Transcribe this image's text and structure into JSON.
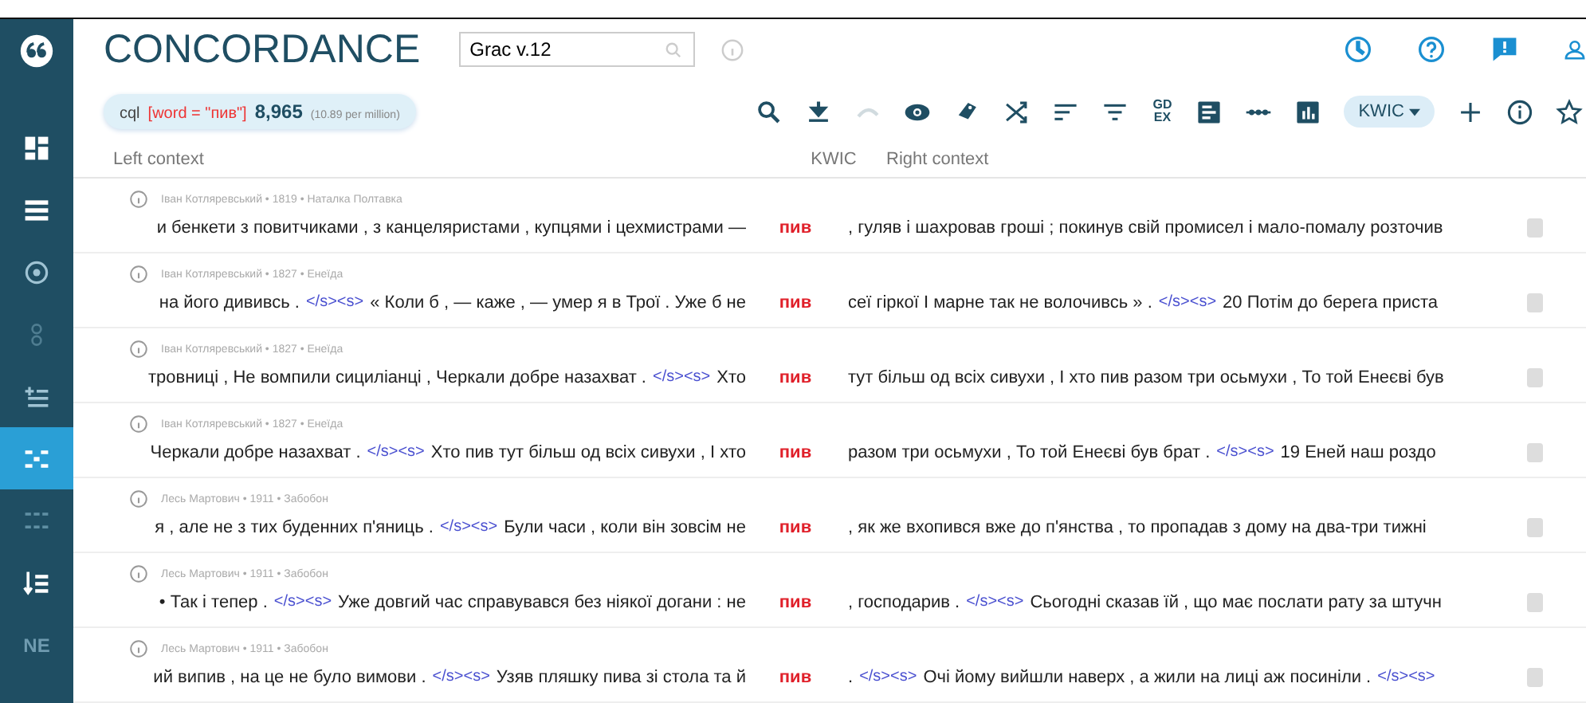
{
  "app": {
    "title": "CONCORDANCE",
    "corpus_field": {
      "value": "Grac v.12"
    }
  },
  "sidebar": {
    "items": [
      {
        "kind": "dashboard",
        "selected": false
      },
      {
        "kind": "list",
        "selected": false
      },
      {
        "kind": "target",
        "selected": false
      },
      {
        "kind": "faint",
        "selected": false
      },
      {
        "kind": "addlist",
        "selected": false
      },
      {
        "kind": "concordance",
        "selected": true
      },
      {
        "kind": "grid",
        "selected": false
      },
      {
        "kind": "sortlist",
        "selected": false
      },
      {
        "kind": "ne",
        "label": "NE",
        "selected": false
      }
    ]
  },
  "header_icons": [
    {
      "kind": "clock"
    },
    {
      "kind": "help"
    },
    {
      "kind": "feedback"
    },
    {
      "kind": "user"
    }
  ],
  "query": {
    "type": "cql",
    "expression": "[word = \"пив\"]",
    "count": "8,965",
    "frequency": "(10.89 per million)"
  },
  "tools": [
    {
      "kind": "search",
      "disabled": false
    },
    {
      "kind": "download",
      "disabled": false
    },
    {
      "kind": "undo",
      "disabled": true
    },
    {
      "kind": "eye",
      "disabled": false
    },
    {
      "kind": "tag",
      "disabled": false
    },
    {
      "kind": "shuffle",
      "disabled": false
    },
    {
      "kind": "sort",
      "disabled": false
    },
    {
      "kind": "filter",
      "disabled": false
    },
    {
      "kind": "gdex",
      "label": "GD EX",
      "disabled": false
    },
    {
      "kind": "doc",
      "disabled": false
    },
    {
      "kind": "dots",
      "disabled": false
    },
    {
      "kind": "chart",
      "disabled": false
    },
    {
      "kind": "dropdown",
      "label": "KWIC"
    },
    {
      "kind": "plus",
      "disabled": false
    },
    {
      "kind": "info",
      "disabled": false
    },
    {
      "kind": "star",
      "disabled": false
    }
  ],
  "columns": {
    "left": "Left context",
    "kwic": "KWIC",
    "right": "Right context"
  },
  "rows": [
    {
      "meta": "Іван Котляревський • 1819 • Наталка Полтавка",
      "left": [
        {
          "kind": "text",
          "text": "и бенкети з повитчиками , з канцеляристами , купцями і цехмистрами —"
        }
      ],
      "kwic": "пив",
      "right": [
        {
          "kind": "text",
          "text": ", гуляв і шахровав гроші ; покинув свій промисел і мало-помалу розточив"
        }
      ]
    },
    {
      "meta": "Іван Котляревський • 1827 • Енеїда",
      "left": [
        {
          "kind": "text",
          "text": "на його дививсь ."
        },
        {
          "kind": "tag",
          "text": "</s><s>"
        },
        {
          "kind": "text",
          "text": "« Коли б , — каже , — умер я в Трої . Уже б не"
        }
      ],
      "kwic": "пив",
      "right": [
        {
          "kind": "text",
          "text": "сеї гіркої І марне так не волочивсь » ."
        },
        {
          "kind": "tag",
          "text": "</s><s>"
        },
        {
          "kind": "text",
          "text": "20 Потім до берега приста"
        }
      ]
    },
    {
      "meta": "Іван Котляревський • 1827 • Енеїда",
      "left": [
        {
          "kind": "text",
          "text": "тровниці , Не вомпили сициліанці , Черкали добре назахват ."
        },
        {
          "kind": "tag",
          "text": "</s><s>"
        },
        {
          "kind": "text",
          "text": "Хто"
        }
      ],
      "kwic": "пив",
      "right": [
        {
          "kind": "text",
          "text": "тут більш од всіх сивухи , І хто пив разом три осьмухи , То той Енеєві був"
        }
      ]
    },
    {
      "meta": "Іван Котляревський • 1827 • Енеїда",
      "left": [
        {
          "kind": "text",
          "text": "Черкали добре назахват ."
        },
        {
          "kind": "tag",
          "text": "</s><s>"
        },
        {
          "kind": "text",
          "text": "Хто пив тут більш од всіх сивухи , І хто"
        }
      ],
      "kwic": "пив",
      "right": [
        {
          "kind": "text",
          "text": "разом три осьмухи , То той Енеєві був брат ."
        },
        {
          "kind": "tag",
          "text": "</s><s>"
        },
        {
          "kind": "text",
          "text": "19 Еней наш роздо"
        }
      ]
    },
    {
      "meta": "Лесь Мартович • 1911 • Забобон",
      "left": [
        {
          "kind": "text",
          "text": "я , але не з тих буденних п'яниць ."
        },
        {
          "kind": "tag",
          "text": "</s><s>"
        },
        {
          "kind": "text",
          "text": "Були часи , коли він зовсім не"
        }
      ],
      "kwic": "пив",
      "right": [
        {
          "kind": "text",
          "text": ", як же вхопився вже до п'янства , то пропадав з дому на два-три тижні"
        }
      ]
    },
    {
      "meta": "Лесь Мартович • 1911 • Забобон",
      "left": [
        {
          "kind": "text",
          "text": "• Так і тепер ."
        },
        {
          "kind": "tag",
          "text": "</s><s>"
        },
        {
          "kind": "text",
          "text": "Уже довгий час справувався без ніякої догани : не"
        }
      ],
      "kwic": "пив",
      "right": [
        {
          "kind": "text",
          "text": ", господарив ."
        },
        {
          "kind": "tag",
          "text": "</s><s>"
        },
        {
          "kind": "text",
          "text": "Сьогодні сказав їй , що має послати рату за штучн"
        }
      ]
    },
    {
      "meta": "Лесь Мартович • 1911 • Забобон",
      "left": [
        {
          "kind": "text",
          "text": "ий випив , на це не було вимови ."
        },
        {
          "kind": "tag",
          "text": "</s><s>"
        },
        {
          "kind": "text",
          "text": "Узяв пляшку пива зі стола та й"
        }
      ],
      "kwic": "пив",
      "right": [
        {
          "kind": "text",
          "text": "."
        },
        {
          "kind": "tag",
          "text": "</s><s>"
        },
        {
          "kind": "text",
          "text": "Очі йому вийшли наверх , а жили на лиці аж посиніли ."
        },
        {
          "kind": "tag",
          "text": "</s><s>"
        }
      ]
    }
  ]
}
